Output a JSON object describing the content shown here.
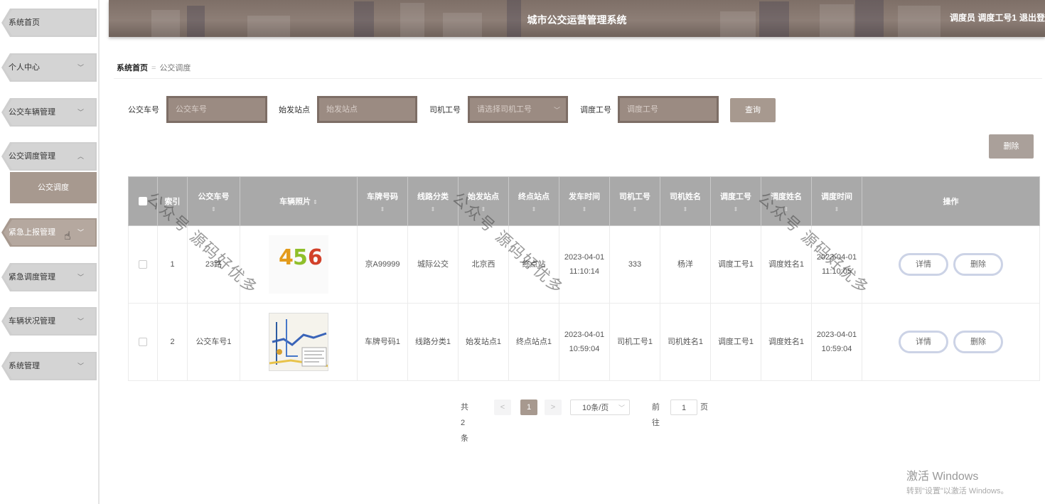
{
  "sidebar": {
    "items": [
      {
        "label": "系统首页"
      },
      {
        "label": "个人中心"
      },
      {
        "label": "公交车辆管理"
      },
      {
        "label": "公交调度管理"
      },
      {
        "label": "紧急上报管理"
      },
      {
        "label": "紧急调度管理"
      },
      {
        "label": "车辆状况管理"
      },
      {
        "label": "系统管理"
      }
    ],
    "sub_item": "公交调度"
  },
  "header": {
    "title": "城市公交运营管理系统",
    "user": "调度员 调度工号1",
    "logout": "退出登"
  },
  "breadcrumb": {
    "home": "系统首页",
    "current": "公交调度"
  },
  "search": {
    "bus_no_label": "公交车号",
    "bus_no_placeholder": "公交车号",
    "start_label": "始发站点",
    "start_placeholder": "始发站点",
    "driver_label": "司机工号",
    "driver_placeholder": "请选择司机工号",
    "dispatch_label": "调度工号",
    "dispatch_placeholder": "调度工号",
    "query_button": "查询"
  },
  "actions": {
    "delete_button": "删除"
  },
  "table": {
    "headers": [
      "索引",
      "公交车号",
      "车辆照片",
      "车牌号码",
      "线路分类",
      "始发站点",
      "终点站点",
      "发车时间",
      "司机工号",
      "司机姓名",
      "调度工号",
      "调度姓名",
      "调度时间",
      "操作"
    ],
    "rows": [
      {
        "index": "1",
        "bus_no": "23路",
        "plate": "京A99999",
        "line": "城际公交",
        "start": "北京西",
        "end": "终点站",
        "depart": "2023-04-01 11:10:14",
        "driver_no": "333",
        "driver_name": "杨洋",
        "dispatch_no": "调度工号1",
        "dispatch_name": "调度姓名1",
        "dispatch_time": "2023-04-01 11:10:05",
        "photo_text": "456"
      },
      {
        "index": "2",
        "bus_no": "公交车号1",
        "plate": "车牌号码1",
        "line": "线路分类1",
        "start": "始发站点1",
        "end": "终点站点1",
        "depart": "2023-04-01 10:59:04",
        "driver_no": "司机工号1",
        "driver_name": "司机姓名1",
        "dispatch_no": "调度工号1",
        "dispatch_name": "调度姓名1",
        "dispatch_time": "2023-04-01 10:59:04",
        "photo_text": ""
      }
    ],
    "detail_label": "详情",
    "delete_label": "删除"
  },
  "pagination": {
    "total": "共 2 条",
    "prev": "<",
    "next": ">",
    "current_page": "1",
    "page_size": "10条/页",
    "goto_label": "前往",
    "goto_value": "1",
    "page_unit": "页"
  },
  "watermark": "公众号 源码好优多",
  "activate": {
    "title": "激活 Windows",
    "subtitle": "转到\"设置\"以激活 Windows。"
  }
}
